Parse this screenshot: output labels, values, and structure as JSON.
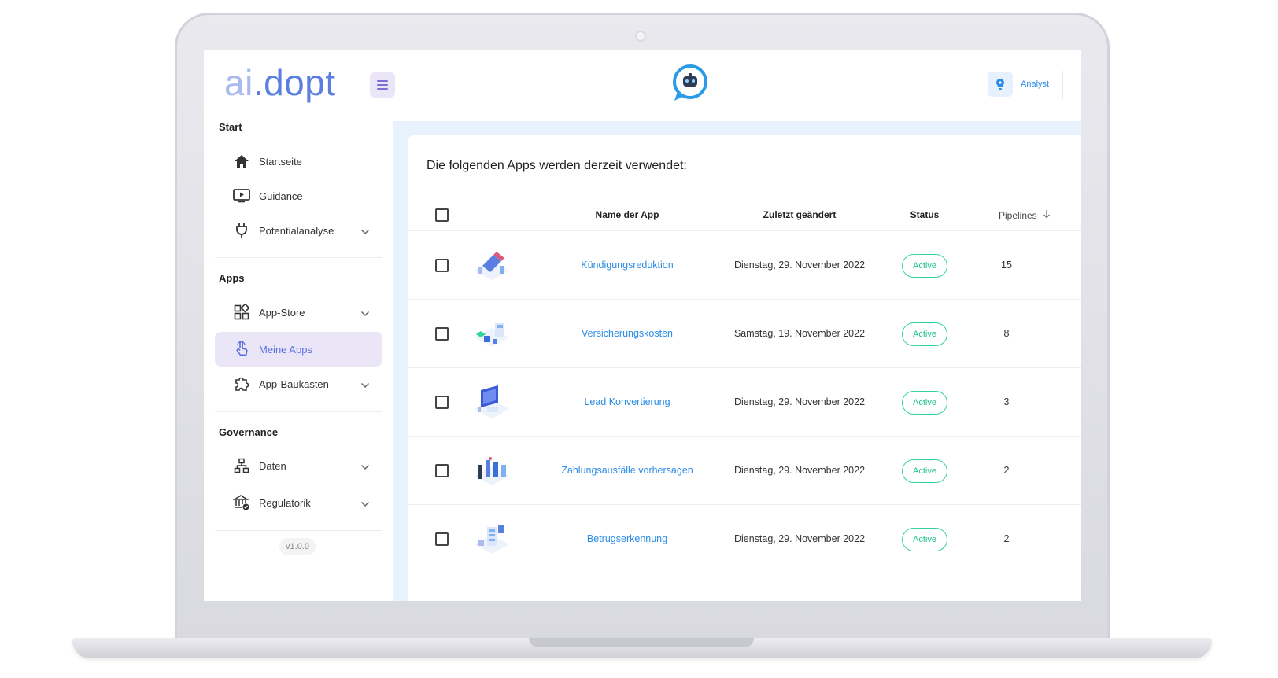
{
  "app": {
    "logo_ai": "ai",
    "logo_rest": ".dopt"
  },
  "header": {
    "user_role": "Analyst"
  },
  "sidebar": {
    "sections": [
      {
        "title": "Start"
      },
      {
        "title": "Apps"
      },
      {
        "title": "Governance"
      }
    ],
    "items": [
      {
        "label": "Startseite",
        "icon": "home-icon"
      },
      {
        "label": "Guidance",
        "icon": "play-screen-icon"
      },
      {
        "label": "Potentialanalyse",
        "icon": "plug-icon",
        "expandable": true
      },
      {
        "label": "App-Store",
        "icon": "grid-icon",
        "expandable": true
      },
      {
        "label": "Meine Apps",
        "icon": "touch-icon",
        "active": true
      },
      {
        "label": "App-Baukasten",
        "icon": "puzzle-icon",
        "expandable": true
      },
      {
        "label": "Daten",
        "icon": "hierarchy-icon",
        "expandable": true
      },
      {
        "label": "Regulatorik",
        "icon": "bank-check-icon",
        "expandable": true
      }
    ],
    "version": "v1.0.0"
  },
  "main": {
    "title": "Die folgenden Apps werden derzeit verwendet:",
    "columns": {
      "name": "Name der App",
      "changed": "Zuletzt geändert",
      "status": "Status",
      "pipelines": "Pipelines"
    },
    "rows": [
      {
        "name": "Kündigungsreduktion",
        "changed": "Dienstag, 29. November 2022",
        "status": "Active",
        "pipelines": "15"
      },
      {
        "name": "Versicherungskosten",
        "changed": "Samstag, 19. November 2022",
        "status": "Active",
        "pipelines": "8"
      },
      {
        "name": "Lead Konvertierung",
        "changed": "Dienstag, 29. November 2022",
        "status": "Active",
        "pipelines": "3"
      },
      {
        "name": "Zahlungsausfälle vorhersagen",
        "changed": "Dienstag, 29. November 2022",
        "status": "Active",
        "pipelines": "2"
      },
      {
        "name": "Betrugserkennung",
        "changed": "Dienstag, 29. November 2022",
        "status": "Active",
        "pipelines": "2"
      }
    ]
  },
  "colors": {
    "accent": "#2b8ce6",
    "active_badge": "#34d399",
    "sidebar_active": "#ebe6f7",
    "main_bg": "#e8f2fc"
  }
}
